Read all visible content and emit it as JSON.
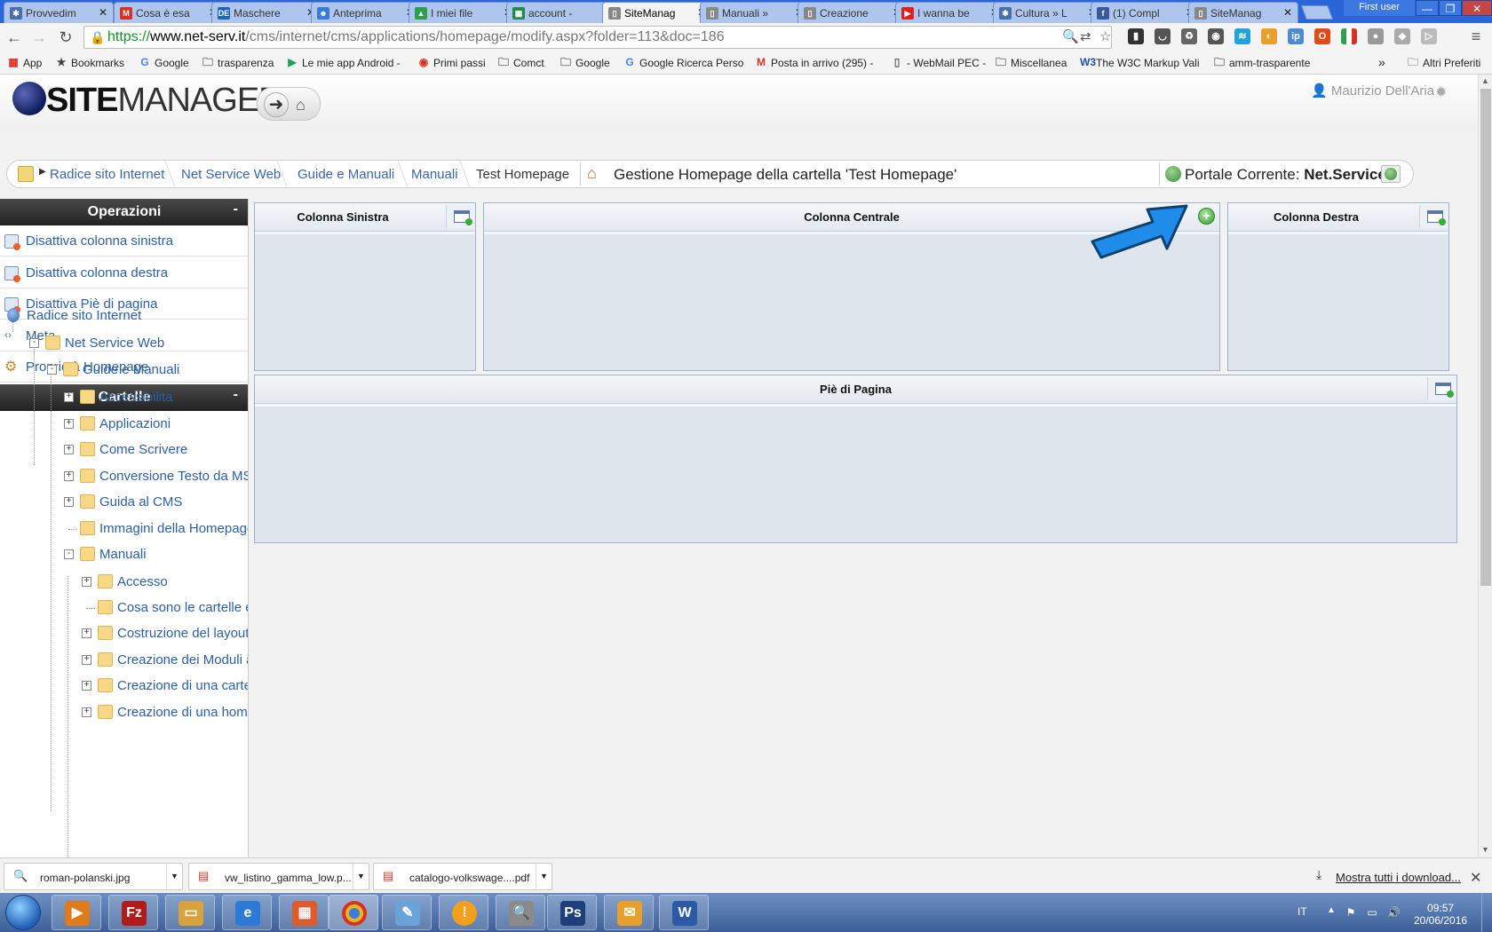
{
  "browser": {
    "tabs": [
      {
        "label": "Provvedim",
        "favicon": "joomla-icon",
        "color": "#4a6ea9"
      },
      {
        "label": "Cosa è esa",
        "favicon": "gmail-icon",
        "color": "#d93025"
      },
      {
        "label": "Maschere",
        "favicon": "de-icon",
        "color": "#1e64b4"
      },
      {
        "label": "Anteprima",
        "favicon": "contacts-icon",
        "color": "#3a7bd5"
      },
      {
        "label": "I miei file",
        "favicon": "drive-icon",
        "color": "#2e9e4f"
      },
      {
        "label": "account - ",
        "favicon": "sheets-icon",
        "color": "#1f8c49"
      },
      {
        "label": "SiteManag",
        "favicon": "doc-icon",
        "color": "#888888",
        "active": true
      },
      {
        "label": "Manuali » ",
        "favicon": "doc-icon",
        "color": "#888888"
      },
      {
        "label": "Creazione ",
        "favicon": "doc-icon",
        "color": "#888888"
      },
      {
        "label": "I wanna be",
        "favicon": "youtube-icon",
        "color": "#e02020"
      },
      {
        "label": "Cultura » L",
        "favicon": "joomla-icon",
        "color": "#4a6ea9"
      },
      {
        "label": "(1) Compl",
        "favicon": "facebook-icon",
        "color": "#3b5998"
      },
      {
        "label": "SiteManag",
        "favicon": "doc-icon",
        "color": "#888888"
      }
    ],
    "profile_label": "First user",
    "url": {
      "scheme": "https://",
      "host": "www.net-serv.it",
      "path": "/cms/internet/cms/applications/homepage/modify.aspx?folder=113&doc=186"
    },
    "bookmarks": [
      {
        "label": "App",
        "icon": "apps-grid-icon"
      },
      {
        "label": "Bookmarks",
        "icon": "star-icon"
      },
      {
        "label": "Google",
        "icon": "google-icon"
      },
      {
        "label": "trasparenza",
        "icon": "folder-icon"
      },
      {
        "label": "Le mie app Android -",
        "icon": "play-store-icon"
      },
      {
        "label": "Primi passi",
        "icon": "chrome-icon"
      },
      {
        "label": "Comct",
        "icon": "folder-icon"
      },
      {
        "label": "Google",
        "icon": "folder-icon"
      },
      {
        "label": "Google Ricerca Perso",
        "icon": "google-icon"
      },
      {
        "label": "Posta in arrivo (295) -",
        "icon": "gmail-icon"
      },
      {
        "label": "- WebMail PEC -",
        "icon": "page-icon"
      },
      {
        "label": "Miscellanea",
        "icon": "folder-icon"
      },
      {
        "label": "The W3C Markup Vali",
        "icon": "w3c-icon"
      },
      {
        "label": "amm-trasparente",
        "icon": "folder-icon"
      }
    ],
    "bookmarks_overflow": "»",
    "other_bookmarks": "Altri Preferiti"
  },
  "app": {
    "logo_bold": "SITE",
    "logo_light": "MANAGER",
    "user_name": "Maurizio Dell'Aria",
    "breadcrumb": [
      "Radice sito Internet",
      "Net Service Web",
      "Guide e Manuali",
      "Manuali",
      "Test Homepage"
    ],
    "page_title": "Gestione Homepage della cartella 'Test Homepage'",
    "portal_label": "Portale Corrente:",
    "portal_value": "Net.Service",
    "operations_header": "Operazioni",
    "operations": [
      {
        "label": "Disattiva colonna sinistra",
        "icon": "layout-left-icon"
      },
      {
        "label": "Disattiva colonna destra",
        "icon": "layout-right-icon"
      },
      {
        "label": "Disattiva Piè di pagina",
        "icon": "layout-footer-icon"
      },
      {
        "label": "Meta",
        "icon": "meta-icon"
      },
      {
        "label": "Proprietà Homepage",
        "icon": "gear-icon"
      }
    ],
    "folders_header": "Cartelle",
    "collapse_symbol": "-",
    "tree": [
      {
        "label": "Radice sito Internet"
      },
      {
        "label": "Net Service Web"
      },
      {
        "label": "Guide e Manuali"
      },
      {
        "label": "Accessibilita"
      },
      {
        "label": "Applicazioni"
      },
      {
        "label": "Come Scrivere"
      },
      {
        "label": "Conversione Testo da MS.Word"
      },
      {
        "label": "Guida al CMS"
      },
      {
        "label": "Immagini della Homepage"
      },
      {
        "label": "Manuali"
      },
      {
        "label": "Accesso"
      },
      {
        "label": "Cosa sono le cartelle e le"
      },
      {
        "label": "Costruzione del layout del"
      },
      {
        "label": "Creazione dei Moduli all'in"
      },
      {
        "label": "Creazione di una cartella"
      },
      {
        "label": "Creazione di una homepage"
      }
    ],
    "columns": {
      "left": "Colonna Sinistra",
      "center": "Colonna Centrale",
      "right": "Colonna Destra",
      "footer": "Piè di Pagina"
    },
    "colors": {
      "accent": "#2c5fa3",
      "arrow": "#1e8ce8",
      "column_bg": "#dfe5ec"
    }
  },
  "downloads": {
    "items": [
      {
        "label": "roman-polanski.jpg",
        "icon": "image-file-icon"
      },
      {
        "label": "vw_listino_gamma_low.p...",
        "icon": "pdf-icon"
      },
      {
        "label": "catalogo-volkswage....pdf",
        "icon": "pdf-icon"
      }
    ],
    "show_all": "Mostra tutti i download..."
  },
  "taskbar": {
    "lang": "IT",
    "time": "09:57",
    "date": "20/06/2016"
  }
}
